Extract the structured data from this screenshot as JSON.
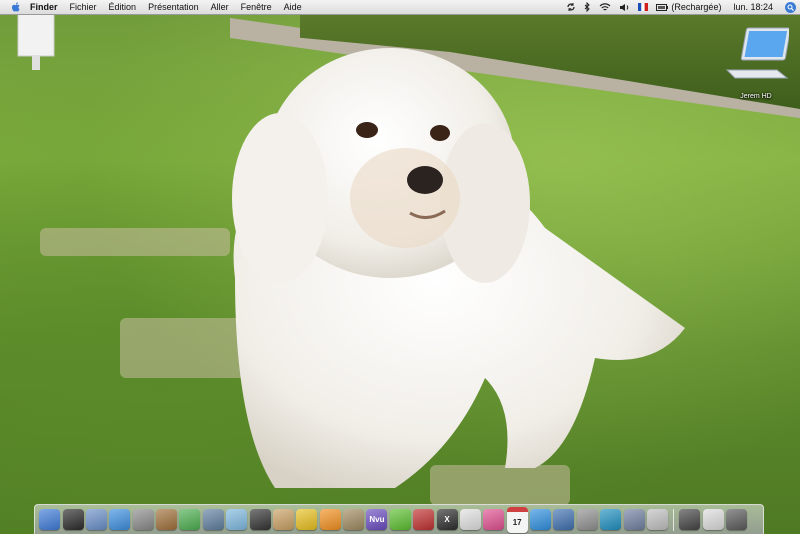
{
  "menubar": {
    "app_name": "Finder",
    "items": [
      "Fichier",
      "Édition",
      "Présentation",
      "Aller",
      "Fenêtre",
      "Aide"
    ],
    "battery_status": "(Rechargée)",
    "clock": "lun. 18:24",
    "icons": [
      "apple-icon",
      "sync-icon",
      "bluetooth-icon",
      "wifi-icon",
      "volume-icon",
      "flag-fr-icon",
      "battery-icon",
      "spotlight-icon"
    ]
  },
  "desktop": {
    "drive_icon": {
      "label": "Jerem HD",
      "icon": "laptop-icon"
    }
  },
  "dock": {
    "apps": [
      {
        "name": "finder",
        "color": "#3f7bd8"
      },
      {
        "name": "dashboard",
        "color": "#2b2b2b"
      },
      {
        "name": "mail",
        "color": "#6a8fc8"
      },
      {
        "name": "safari",
        "color": "#3d8fe0"
      },
      {
        "name": "time-machine",
        "color": "#8a8a8a"
      },
      {
        "name": "address-book",
        "color": "#a0703a"
      },
      {
        "name": "itunes",
        "color": "#4caf50"
      },
      {
        "name": "preview",
        "color": "#5f7f9f"
      },
      {
        "name": "iphoto",
        "color": "#7fb9e0"
      },
      {
        "name": "photo-booth",
        "color": "#333333"
      },
      {
        "name": "preview-2",
        "color": "#c9a063"
      },
      {
        "name": "adium",
        "color": "#e8c020"
      },
      {
        "name": "vlc",
        "color": "#f29020"
      },
      {
        "name": "package",
        "color": "#a08a60"
      },
      {
        "name": "nvu",
        "color": "#6a4cc0",
        "label": "Nvu"
      },
      {
        "name": "app-green",
        "color": "#5cbf30"
      },
      {
        "name": "flashget",
        "color": "#c03030"
      },
      {
        "name": "x11",
        "color": "#2d2d2d",
        "label": "X"
      },
      {
        "name": "textedit",
        "color": "#e0e0e0"
      },
      {
        "name": "colorsync",
        "color": "#e05090"
      },
      {
        "name": "ical",
        "color": "#d04040",
        "label": "17"
      },
      {
        "name": "search-app",
        "color": "#3090e0"
      },
      {
        "name": "app-blue",
        "color": "#4070b0"
      },
      {
        "name": "app-gray",
        "color": "#909090"
      },
      {
        "name": "app-cyan",
        "color": "#2090c0"
      },
      {
        "name": "app-mixed",
        "color": "#7080a0"
      },
      {
        "name": "app-doc",
        "color": "#c0c0c0"
      }
    ],
    "others": [
      {
        "name": "downloads-stack",
        "color": "#444444"
      },
      {
        "name": "documents-stack",
        "color": "#dcdcdc"
      },
      {
        "name": "trash",
        "color": "#5a5a5a"
      }
    ]
  }
}
